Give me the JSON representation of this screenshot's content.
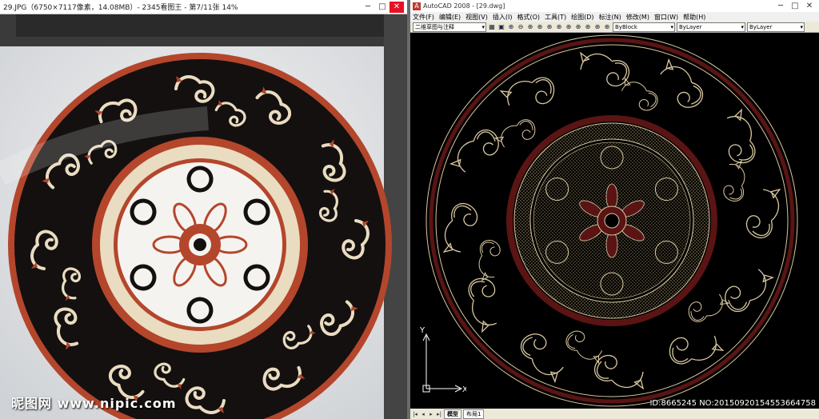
{
  "viewer": {
    "title": "29.JPG（6750×7117像素，14.08MB）- 2345看图王 - 第7/11张 14%",
    "min_glyph": "─",
    "max_glyph": "□",
    "close_glyph": "✕",
    "watermark": "昵图网 www.nipic.com"
  },
  "acad": {
    "logo": "A",
    "title": "AutoCAD 2008 - [29.dwg]",
    "menu": [
      "文件(F)",
      "编辑(E)",
      "视图(V)",
      "插入(I)",
      "格式(O)",
      "工具(T)",
      "绘图(D)",
      "标注(N)",
      "修改(M)",
      "窗口(W)",
      "帮助(H)"
    ],
    "workspace": "二维草图与注释",
    "color_select": "ByBlock",
    "linetype_select": "ByLayer",
    "lineweight_select": "ByLayer",
    "ucs_x": "X",
    "ucs_y": "Y",
    "tabs": [
      "模型",
      "布局1"
    ],
    "id_text": "ID:8665245 NO:20150920154553664758"
  },
  "colors": {
    "marble_black": "#141010",
    "marble_red": "#b4462c",
    "marble_cream": "#eadcc0",
    "cad_line": "#d9c9a0",
    "cad_red": "#5a1414"
  }
}
